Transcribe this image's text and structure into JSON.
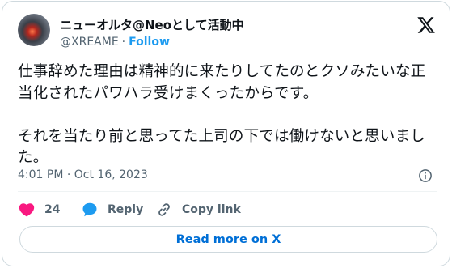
{
  "tweet": {
    "display_name": "ニューオルタ@Neoとして活動中",
    "handle": "@XREAME",
    "separator": "·",
    "follow_label": "Follow",
    "text": "仕事辞めた理由は精神的に来たりしてたのとクソみたいな正当化されたパワハラ受けまくったからです。\n\nそれを当たり前と思ってた上司の下では働けないと思いました。",
    "timestamp": "4:01 PM · Oct 16, 2023"
  },
  "actions": {
    "like_count": "24",
    "reply_label": "Reply",
    "copy_link_label": "Copy link"
  },
  "footer": {
    "read_more_label": "Read more on X"
  },
  "colors": {
    "accent": "#1d9bf0",
    "like": "#f91880",
    "secondary_text": "#536471",
    "border": "#cfd9de"
  },
  "icons": [
    "x-logo-icon",
    "info-icon",
    "heart-icon",
    "reply-bubble-icon",
    "link-icon"
  ]
}
